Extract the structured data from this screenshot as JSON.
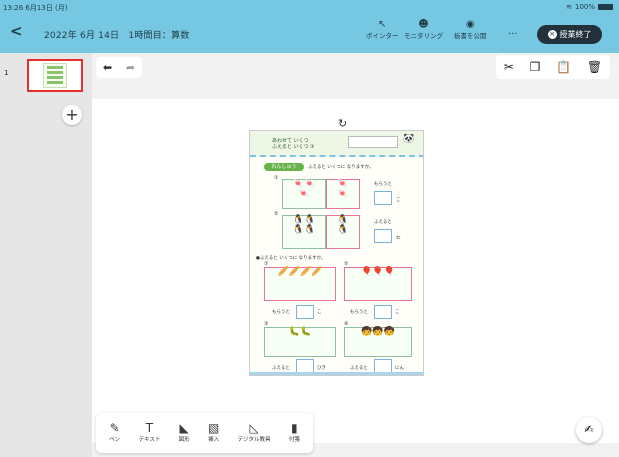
{
  "status": {
    "time_date": "13:26  6月13日 (月)",
    "wifi_icon": "wifi-icon",
    "battery_text": "100%"
  },
  "header": {
    "back_icon": "chevron-left-icon",
    "title": "2022年 6月 14日　1時間目：算数",
    "tools": [
      {
        "label": "ポインター",
        "icon": "pointer-icon"
      },
      {
        "label": "モニタリング",
        "icon": "monitoring-icon"
      },
      {
        "label": "板書を公開",
        "icon": "eye-icon"
      }
    ],
    "more_icon": "more-icon",
    "end_button": "授業終了"
  },
  "sidebar": {
    "page_number": "1",
    "add_page_icon": "plus-icon"
  },
  "edit_toolbar": {
    "undo_icon": "undo-icon",
    "redo_icon": "redo-icon",
    "actions": [
      "cut-icon",
      "copy-icon",
      "paste-icon",
      "delete-icon"
    ]
  },
  "worksheet": {
    "header_line1": "あわせて いくつ",
    "header_line2": "ふえると いくつ ③",
    "section_title": "れんしゅう",
    "instruction1": "ふえると いくつに なりますか。",
    "instruction2": "●ふえると いくつに なりますか。",
    "label_receive": "もらうと",
    "label_increase": "ふえると",
    "unit_ko": "こ",
    "unit_wa": "わ",
    "unit_hiki": "ひき",
    "unit_nin": "にん",
    "nums": [
      "①",
      "②",
      "③",
      "④"
    ]
  },
  "bottom_tools": [
    {
      "label": "ペン",
      "icon": "pen-icon"
    },
    {
      "label": "テキスト",
      "icon": "text-icon"
    },
    {
      "label": "図形",
      "icon": "shapes-icon"
    },
    {
      "label": "挿入",
      "icon": "image-icon"
    },
    {
      "label": "デジタル教具",
      "icon": "ruler-icon"
    },
    {
      "label": "付箋",
      "icon": "sticky-note-icon"
    }
  ],
  "fab_icon": "edit-note-icon"
}
